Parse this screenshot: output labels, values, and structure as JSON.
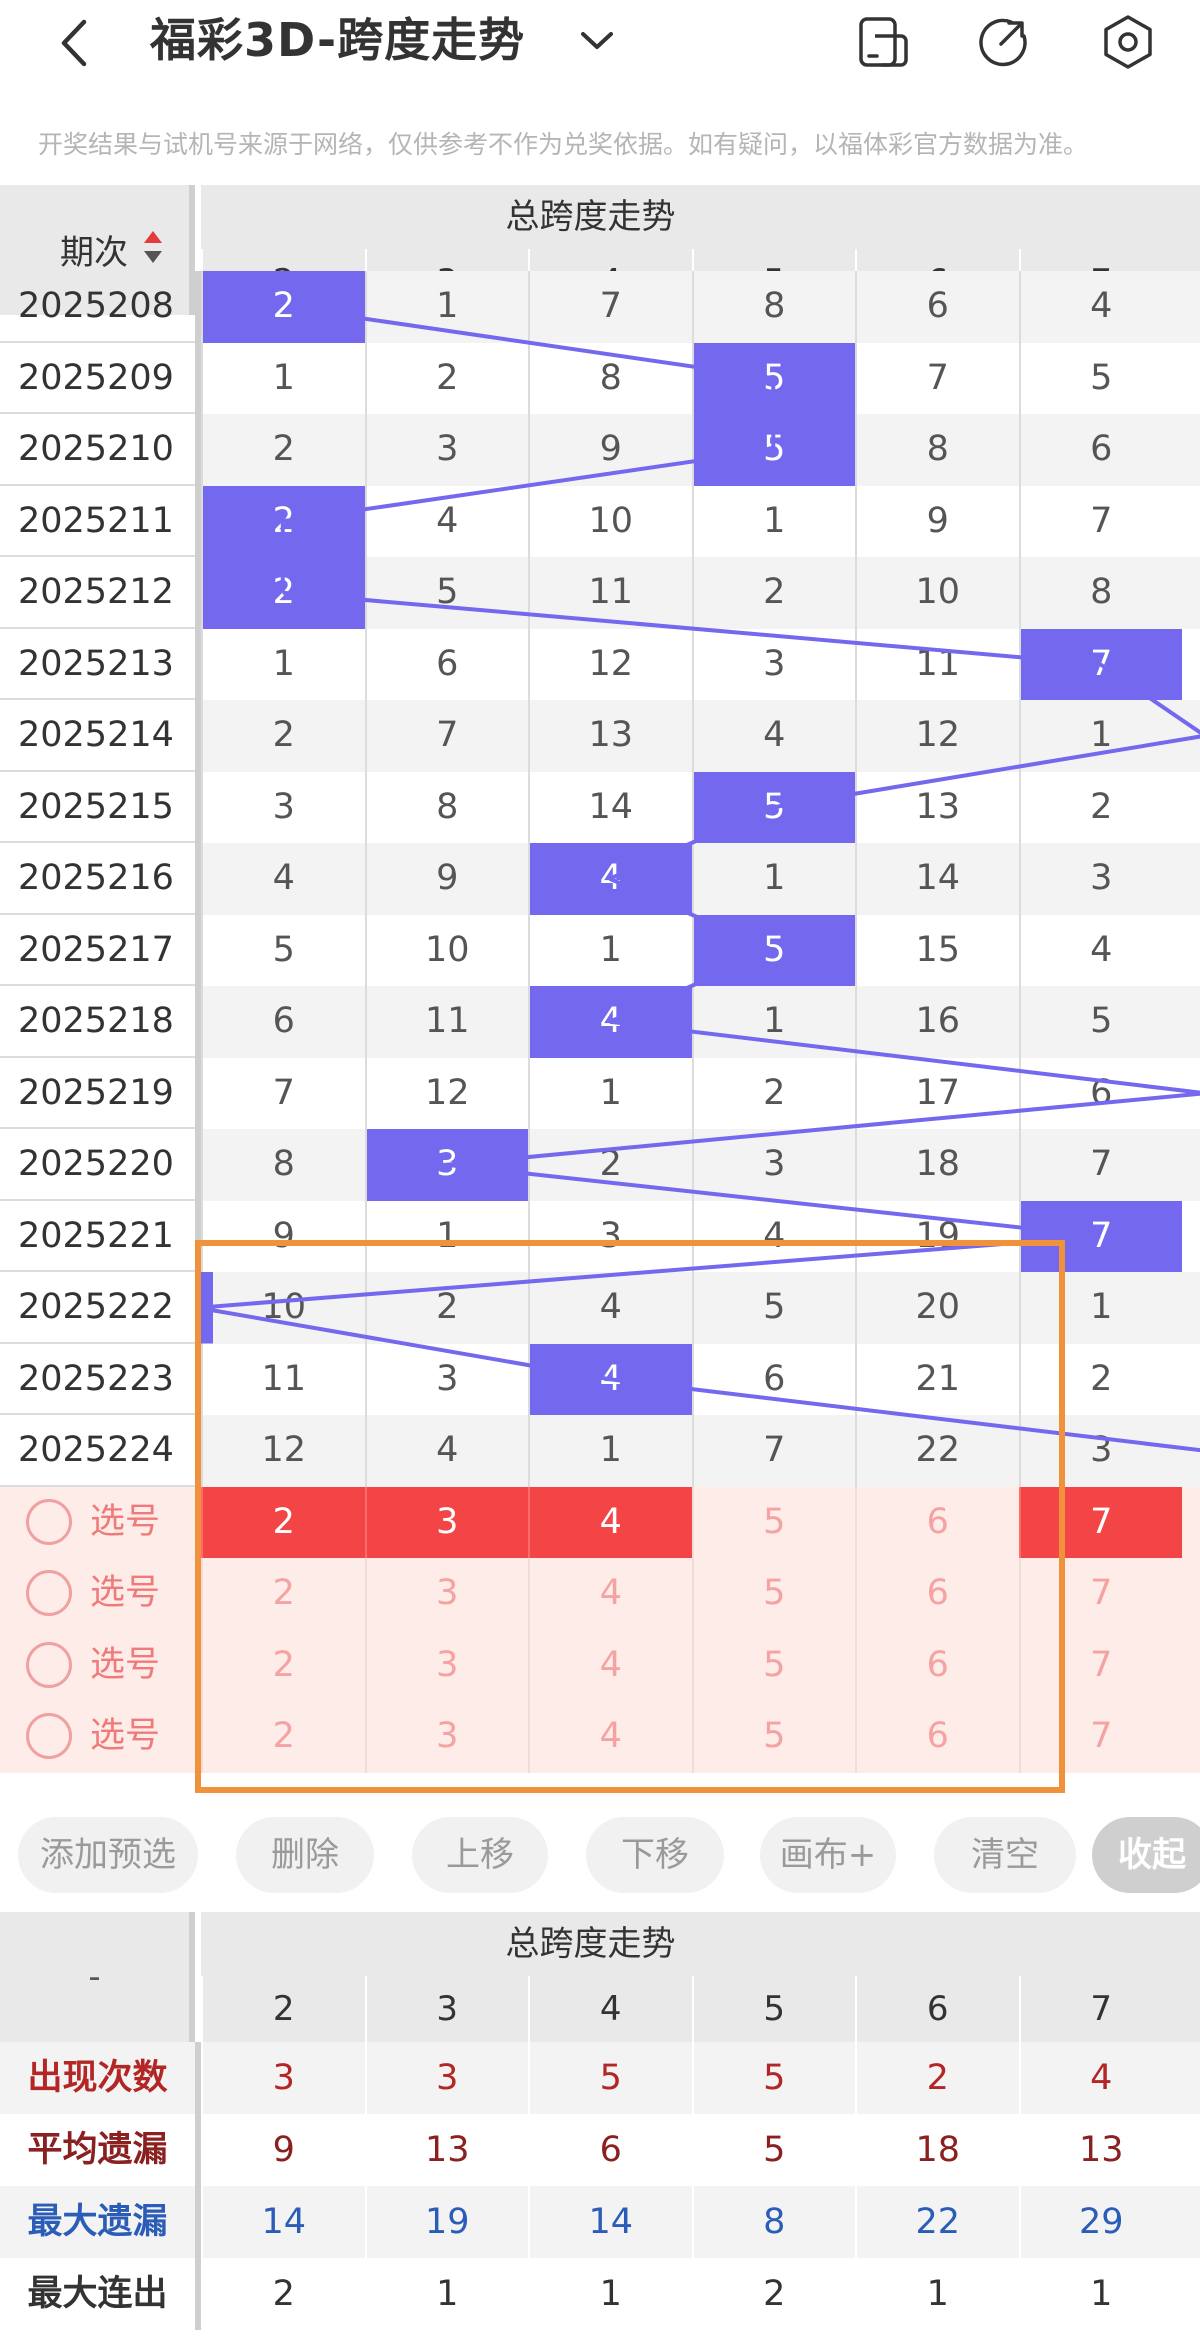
{
  "header": {
    "title": "福彩3D-跨度走势",
    "back_icon": "chevron-left-icon",
    "dropdown_icon": "chevron-down-icon",
    "actions": [
      "split-screen-icon",
      "share-icon",
      "settings-icon"
    ]
  },
  "notice": "开奖结果与试机号来源于网络，仅供参考不作为兑奖依据。如有疑问，以福体彩官方数据为准。",
  "chart": {
    "period_label": "期次",
    "group_title": "总跨度走势",
    "columns": [
      "2",
      "3",
      "4",
      "5",
      "6",
      "7"
    ],
    "rows": [
      {
        "period": "2025208",
        "cells": [
          "2",
          "1",
          "7",
          "8",
          "6",
          "4"
        ],
        "hit": 0
      },
      {
        "period": "2025209",
        "cells": [
          "1",
          "2",
          "8",
          "5",
          "7",
          "5"
        ],
        "hit": 3
      },
      {
        "period": "2025210",
        "cells": [
          "2",
          "3",
          "9",
          "5",
          "8",
          "6"
        ],
        "hit": 3
      },
      {
        "period": "2025211",
        "cells": [
          "2",
          "4",
          "10",
          "1",
          "9",
          "7"
        ],
        "hit": 0
      },
      {
        "period": "2025212",
        "cells": [
          "2",
          "5",
          "11",
          "2",
          "10",
          "8"
        ],
        "hit": 0
      },
      {
        "period": "2025213",
        "cells": [
          "1",
          "6",
          "12",
          "3",
          "11",
          "7"
        ],
        "hit": 5
      },
      {
        "period": "2025214",
        "cells": [
          "2",
          "7",
          "13",
          "4",
          "12",
          "1"
        ],
        "hit": -1
      },
      {
        "period": "2025215",
        "cells": [
          "3",
          "8",
          "14",
          "5",
          "13",
          "2"
        ],
        "hit": 3
      },
      {
        "period": "2025216",
        "cells": [
          "4",
          "9",
          "4",
          "1",
          "14",
          "3"
        ],
        "hit": 2
      },
      {
        "period": "2025217",
        "cells": [
          "5",
          "10",
          "1",
          "5",
          "15",
          "4"
        ],
        "hit": 3
      },
      {
        "period": "2025218",
        "cells": [
          "6",
          "11",
          "4",
          "1",
          "16",
          "5"
        ],
        "hit": 2
      },
      {
        "period": "2025219",
        "cells": [
          "7",
          "12",
          "1",
          "2",
          "17",
          "6"
        ],
        "hit": -1
      },
      {
        "period": "2025220",
        "cells": [
          "8",
          "3",
          "2",
          "3",
          "18",
          "7"
        ],
        "hit": 1
      },
      {
        "period": "2025221",
        "cells": [
          "9",
          "1",
          "3",
          "4",
          "19",
          "7"
        ],
        "hit": 5
      },
      {
        "period": "2025222",
        "cells": [
          "10",
          "2",
          "4",
          "5",
          "20",
          "1"
        ],
        "hit": -1
      },
      {
        "period": "2025223",
        "cells": [
          "11",
          "3",
          "4",
          "6",
          "21",
          "2"
        ],
        "hit": 2
      },
      {
        "period": "2025224",
        "cells": [
          "12",
          "4",
          "1",
          "7",
          "22",
          "3"
        ],
        "hit": -1
      }
    ],
    "pick_rows": [
      {
        "label": "选号",
        "cells": [
          "2",
          "3",
          "4",
          "5",
          "6",
          "7"
        ],
        "selected": [
          0,
          1,
          2,
          5
        ]
      },
      {
        "label": "选号",
        "cells": [
          "2",
          "3",
          "4",
          "5",
          "6",
          "7"
        ],
        "selected": []
      },
      {
        "label": "选号",
        "cells": [
          "2",
          "3",
          "4",
          "5",
          "6",
          "7"
        ],
        "selected": []
      },
      {
        "label": "选号",
        "cells": [
          "2",
          "3",
          "4",
          "5",
          "6",
          "7"
        ],
        "selected": []
      }
    ],
    "hit_color": "#7468ee",
    "pick_color": "#f34545",
    "highlight_color": "#f0913c"
  },
  "toolbar": {
    "buttons": [
      "添加预选",
      "删除",
      "上移",
      "下移",
      "画布+",
      "清空",
      "收起"
    ]
  },
  "stats": {
    "left_label": "-",
    "group_title": "总跨度走势",
    "columns": [
      "2",
      "3",
      "4",
      "5",
      "6",
      "7"
    ],
    "rows": [
      {
        "label": "出现次数",
        "values": [
          "3",
          "3",
          "5",
          "5",
          "2",
          "4"
        ],
        "color": "#b32626"
      },
      {
        "label": "平均遗漏",
        "values": [
          "9",
          "13",
          "6",
          "5",
          "18",
          "13"
        ],
        "color": "#8a2020"
      },
      {
        "label": "最大遗漏",
        "values": [
          "14",
          "19",
          "14",
          "8",
          "22",
          "29"
        ],
        "color": "#2b5db8"
      },
      {
        "label": "最大连出",
        "values": [
          "2",
          "1",
          "1",
          "2",
          "1",
          "1"
        ],
        "color": "#333333"
      }
    ]
  }
}
